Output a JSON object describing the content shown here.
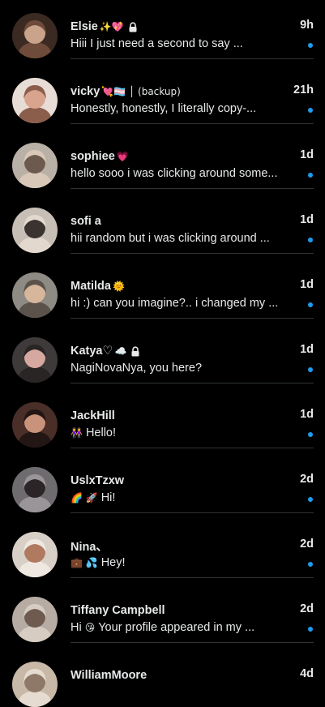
{
  "conversations": [
    {
      "name": "Elsie",
      "badge": "✨💖",
      "locked": true,
      "time": "9h",
      "preview": "Hiii I just need a second to say ...",
      "preview_emoji": "",
      "unread": true,
      "avatar_colors": [
        "#3b2a22",
        "#c9a48a",
        "#6e4b3a"
      ]
    },
    {
      "name": "vicky",
      "badge": "💘🏳️‍⚧️ │ (backup)",
      "locked": false,
      "time": "21h",
      "preview": "Honestly, honestly, I literally copy-...",
      "preview_emoji": "",
      "unread": true,
      "avatar_colors": [
        "#e8ddd6",
        "#d8a48e",
        "#8b5e4c"
      ]
    },
    {
      "name": "sophiee",
      "badge": "💗",
      "locked": false,
      "time": "1d",
      "preview": "hello sooo i was clicking around some...",
      "preview_emoji": "",
      "unread": true,
      "avatar_colors": [
        "#b9b0a6",
        "#6c5a4e",
        "#d9c7b8"
      ]
    },
    {
      "name": "sofi a",
      "badge": "",
      "locked": false,
      "time": "1d",
      "preview": "hii random but i was clicking around ...",
      "preview_emoji": "",
      "unread": true,
      "avatar_colors": [
        "#c7beb5",
        "#3a3330",
        "#e3d8cd"
      ]
    },
    {
      "name": "Matilda",
      "badge": "🌞",
      "locked": false,
      "time": "1d",
      "preview": "hi :) can you imagine?.. i changed my ...",
      "preview_emoji": "",
      "unread": true,
      "avatar_colors": [
        "#8e8a84",
        "#d7b79c",
        "#5b524c"
      ]
    },
    {
      "name": "Katya♡",
      "badge": "☁️",
      "locked": true,
      "time": "1d",
      "preview": "NagiNovaNya, you here?",
      "preview_emoji": "",
      "unread": true,
      "avatar_colors": [
        "#3f3a3a",
        "#d6a9a0",
        "#2a2525"
      ]
    },
    {
      "name": "JackHill",
      "badge": "",
      "locked": false,
      "time": "1d",
      "preview": "Hello!",
      "preview_emoji": "👭",
      "unread": true,
      "avatar_colors": [
        "#4a2f28",
        "#c9927a",
        "#231715"
      ]
    },
    {
      "name": "UslxTzxw",
      "badge": "",
      "locked": false,
      "time": "2d",
      "preview": "Hi!",
      "preview_emoji": "🌈 🚀",
      "unread": true,
      "avatar_colors": [
        "#6f6c70",
        "#2b2527",
        "#9a9599"
      ]
    },
    {
      "name": "Nina、",
      "badge": "",
      "locked": false,
      "time": "2d",
      "preview": "Hey!",
      "preview_emoji": "💼 💦",
      "unread": true,
      "avatar_colors": [
        "#d8cfc6",
        "#b07a60",
        "#efe8e1"
      ]
    },
    {
      "name": "Tiffany Campbell",
      "badge": "",
      "locked": false,
      "time": "2d",
      "preview": "Your profile appeared in my ...",
      "preview_prefix": "Hi",
      "preview_emoji": "😘",
      "unread": true,
      "avatar_colors": [
        "#b6aca4",
        "#6e5a4f",
        "#d6ccc2"
      ]
    },
    {
      "name": "WilliamMoore",
      "badge": "",
      "locked": false,
      "time": "4d",
      "preview": "",
      "preview_emoji": "",
      "unread": false,
      "avatar_colors": [
        "#c8b8a8",
        "#8e7868",
        "#e6dbd0"
      ]
    }
  ],
  "colors": {
    "background": "#000000",
    "text": "#e7e9ea",
    "unread_dot": "#1d9bf0",
    "divider": "#2f3336"
  },
  "icons": {
    "lock": "lock-icon",
    "unread": "unread-dot"
  }
}
